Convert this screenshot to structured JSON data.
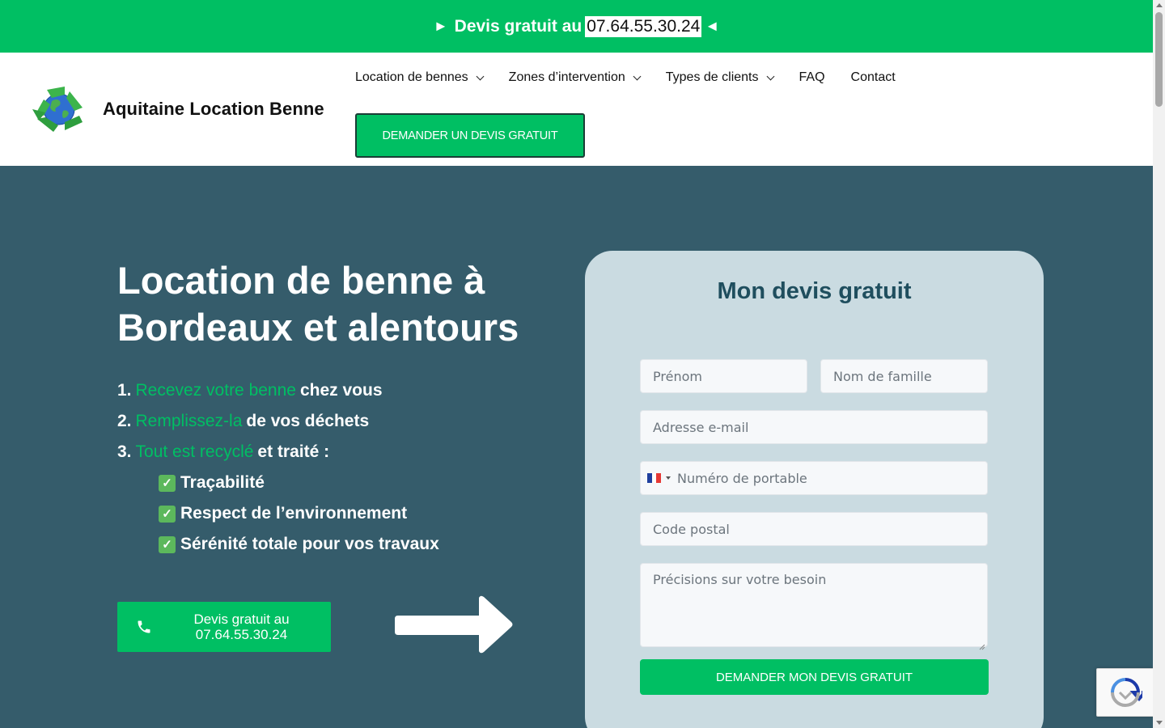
{
  "topbar": {
    "prefix_arrow": "►",
    "text": "Devis gratuit au",
    "phone": "07.64.55.30.24",
    "suffix_arrow": "◄"
  },
  "header": {
    "brand": "Aquitaine Location Benne",
    "logo_icon": "recycling-globe-icon",
    "nav": [
      {
        "label": "Location de bennes",
        "has_dropdown": true
      },
      {
        "label": "Zones d’intervention",
        "has_dropdown": true
      },
      {
        "label": "Types de clients",
        "has_dropdown": true
      },
      {
        "label": "FAQ",
        "has_dropdown": false
      },
      {
        "label": "Contact",
        "has_dropdown": false
      }
    ],
    "cta_label": "DEMANDER UN DEVIS GRATUIT"
  },
  "hero": {
    "title": "Location de benne à Bordeaux et alentours",
    "steps": [
      {
        "num": "1.",
        "highlight": "Recevez votre benne",
        "rest": "chez vous"
      },
      {
        "num": "2.",
        "highlight": "Remplissez-la",
        "rest": "de vos déchets"
      },
      {
        "num": "3.",
        "highlight": "Tout est recyclé",
        "rest": "et traité :"
      }
    ],
    "checks": [
      "Traçabilité",
      "Respect de l’environnement",
      "Sérénité totale pour vos travaux"
    ],
    "cta_line1": "Devis gratuit au",
    "cta_line2": "07.64.55.30.24"
  },
  "form": {
    "title": "Mon devis gratuit",
    "first_name_placeholder": "Prénom",
    "last_name_placeholder": "Nom de famille",
    "email_placeholder": "Adresse e-mail",
    "phone_placeholder": "Numéro de portable",
    "postal_placeholder": "Code postal",
    "details_placeholder": "Précisions sur votre besoin",
    "submit_label": "DEMANDER MON DEVIS GRATUIT"
  },
  "colors": {
    "brand_green": "#00bf63",
    "hero_bg": "#355c6b",
    "card_bg": "#cadbe1",
    "form_title": "#1f4e5e"
  }
}
